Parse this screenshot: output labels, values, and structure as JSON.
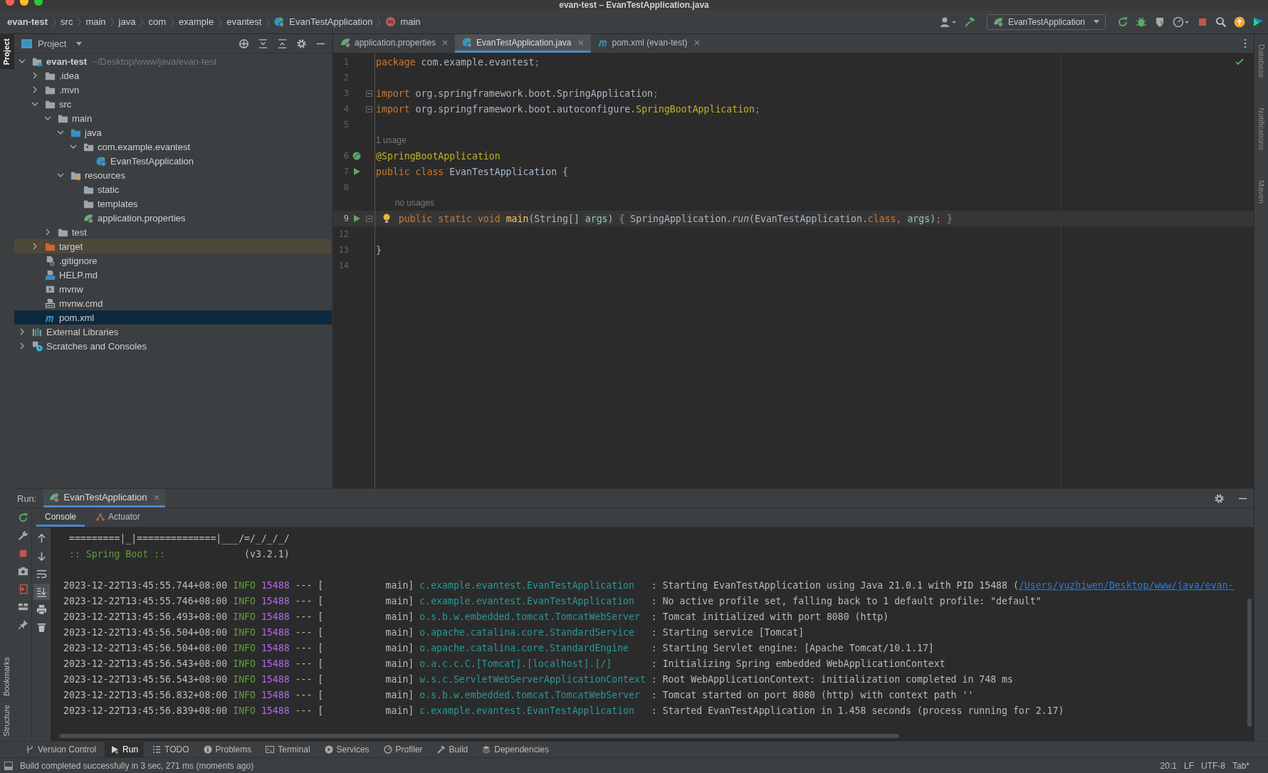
{
  "window": {
    "title": "evan-test – EvanTestApplication.java"
  },
  "breadcrumbs": [
    {
      "label": "evan-test",
      "kind": "project"
    },
    {
      "label": "src",
      "kind": "plain"
    },
    {
      "label": "main",
      "kind": "plain"
    },
    {
      "label": "java",
      "kind": "plain"
    },
    {
      "label": "com",
      "kind": "plain"
    },
    {
      "label": "example",
      "kind": "plain"
    },
    {
      "label": "evantest",
      "kind": "plain"
    },
    {
      "label": "EvanTestApplication",
      "kind": "class"
    },
    {
      "label": "main",
      "kind": "method"
    }
  ],
  "run_configuration": {
    "label": "EvanTestApplication"
  },
  "left_strip": {
    "top": [
      {
        "label": "Project",
        "selected": true
      }
    ],
    "bottom": [
      {
        "label": "Bookmarks",
        "selected": false
      },
      {
        "label": "Structure",
        "selected": false
      }
    ]
  },
  "right_strip": [
    {
      "label": "Database",
      "selected": false
    },
    {
      "label": "Notifications",
      "selected": false
    },
    {
      "label": "Maven",
      "selected": false
    }
  ],
  "project_panel": {
    "title": "Project",
    "tree": [
      {
        "label": "evan-test",
        "hint": "~/Desktop/www/java/evan-test",
        "kind": "module",
        "expanded": true,
        "selected": false,
        "children": [
          {
            "label": ".idea",
            "kind": "folder",
            "expanded": false,
            "selected": false
          },
          {
            "label": ".mvn",
            "kind": "folder",
            "expanded": false,
            "selected": false
          },
          {
            "label": "src",
            "kind": "folder",
            "expanded": true,
            "selected": false,
            "children": [
              {
                "label": "main",
                "kind": "folder",
                "expanded": true,
                "selected": false,
                "children": [
                  {
                    "label": "java",
                    "kind": "source-folder",
                    "expanded": true,
                    "selected": false,
                    "children": [
                      {
                        "label": "com.example.evantest",
                        "kind": "package",
                        "expanded": true,
                        "selected": false,
                        "children": [
                          {
                            "label": "EvanTestApplication",
                            "kind": "spring-class",
                            "selected": false
                          }
                        ]
                      }
                    ]
                  },
                  {
                    "label": "resources",
                    "kind": "resources-folder",
                    "expanded": true,
                    "selected": false,
                    "children": [
                      {
                        "label": "static",
                        "kind": "folder",
                        "selected": false
                      },
                      {
                        "label": "templates",
                        "kind": "folder",
                        "selected": false
                      },
                      {
                        "label": "application.properties",
                        "kind": "spring-file",
                        "selected": false
                      }
                    ]
                  }
                ]
              },
              {
                "label": "test",
                "kind": "folder",
                "expanded": false,
                "selected": false
              }
            ]
          },
          {
            "label": "target",
            "kind": "excluded-folder",
            "expanded": false,
            "selected": false
          },
          {
            "label": ".gitignore",
            "kind": "ignore-file",
            "selected": false
          },
          {
            "label": "HELP.md",
            "kind": "markdown-file",
            "selected": false
          },
          {
            "label": "mvnw",
            "kind": "script-file",
            "selected": false
          },
          {
            "label": "mvnw.cmd",
            "kind": "cmd-file",
            "selected": false
          },
          {
            "label": "pom.xml",
            "kind": "maven-file",
            "selected": true
          }
        ]
      },
      {
        "label": "External Libraries",
        "kind": "libraries",
        "expanded": false,
        "selected": false
      },
      {
        "label": "Scratches and Consoles",
        "kind": "scratches",
        "expanded": false,
        "selected": false
      }
    ]
  },
  "editor": {
    "tabs": [
      {
        "label": "application.properties",
        "kind": "spring-file",
        "selected": false
      },
      {
        "label": "EvanTestApplication.java",
        "kind": "spring-class",
        "selected": true
      },
      {
        "label": "pom.xml (evan-test)",
        "kind": "maven-file",
        "selected": false
      }
    ],
    "lines": [
      {
        "number": "1",
        "fold": false,
        "current": false,
        "tokens": [
          {
            "kind": "keyword",
            "text": "package "
          },
          {
            "kind": "plain",
            "text": "com.example.evantest"
          },
          {
            "kind": "keyword",
            "text": ";"
          }
        ]
      },
      {
        "number": "2",
        "fold": false,
        "current": false
      },
      {
        "number": "3",
        "fold": true,
        "current": false,
        "tokens": [
          {
            "kind": "keyword",
            "text": "import "
          },
          {
            "kind": "plain",
            "text": "org.springframework.boot.SpringApplication"
          },
          {
            "kind": "keyword",
            "text": ";"
          }
        ]
      },
      {
        "number": "4",
        "fold": true,
        "current": false,
        "tokens": [
          {
            "kind": "keyword",
            "text": "import "
          },
          {
            "kind": "plain",
            "text": "org.springframework.boot.autoconfigure."
          },
          {
            "kind": "annotation",
            "text": "SpringBootApplication"
          },
          {
            "kind": "keyword",
            "text": ";"
          }
        ]
      },
      {
        "number": "5",
        "fold": false,
        "current": false
      },
      {
        "number": "6",
        "hint": "1 usage",
        "gutter": {
          "kind": "bean"
        },
        "fold": false,
        "current": false,
        "tokens": [
          {
            "kind": "annotation",
            "text": "@SpringBootApplication"
          }
        ]
      },
      {
        "number": "7",
        "gutter": {
          "kind": "run"
        },
        "fold": false,
        "current": false,
        "tokens": [
          {
            "kind": "keyword",
            "text": "public class "
          },
          {
            "kind": "plain",
            "text": "EvanTestApplication {"
          }
        ]
      },
      {
        "number": "8",
        "fold": false,
        "current": false
      },
      {
        "number": "9",
        "hint": "no usages",
        "gutter": {
          "kind": "run"
        },
        "fold": true,
        "current": true,
        "intention": true,
        "tokens": [
          {
            "kind": "keyword",
            "text": "    public static void "
          },
          {
            "kind": "method",
            "text": "main"
          },
          {
            "kind": "plain",
            "text": "(String[] "
          },
          {
            "kind": "param",
            "text": "args"
          },
          {
            "kind": "plain",
            "text": ") "
          },
          {
            "kind": "folded",
            "text": "{"
          },
          {
            "kind": "plain",
            "text": " SpringApplication."
          },
          {
            "kind": "static-call",
            "text": "run"
          },
          {
            "kind": "plain",
            "text": "(EvanTestApplication."
          },
          {
            "kind": "keyword",
            "text": "class, "
          },
          {
            "kind": "param",
            "text": "args"
          },
          {
            "kind": "plain",
            "text": ")"
          },
          {
            "kind": "keyword",
            "text": "; "
          },
          {
            "kind": "folded",
            "text": "}"
          }
        ]
      },
      {
        "number": "12",
        "fold": false,
        "current": false
      },
      {
        "number": "13",
        "fold": false,
        "current": false,
        "tokens": [
          {
            "kind": "plain",
            "text": "}"
          }
        ]
      },
      {
        "number": "14",
        "fold": false,
        "current": false
      }
    ]
  },
  "run_panel": {
    "label": "Run:",
    "tabs": [
      {
        "label": "EvanTestApplication",
        "selected": true
      }
    ],
    "subtabs": [
      {
        "label": "Console",
        "kind": "console",
        "selected": true
      },
      {
        "label": "Actuator",
        "kind": "actuator",
        "selected": false
      }
    ],
    "console": {
      "banner_rule": " =========|_|==============|___/=/_/_/_/",
      "banner_label": " :: Spring Boot :: ",
      "banner_version": "             (v3.2.1)",
      "logs": [
        {
          "timestamp": "2023-12-22T13:45:55.744+08:00",
          "level": "INFO",
          "pid": "15488",
          "thread": "--- [           main]",
          "logger": "c.example.evantest.EvanTestApplication",
          "message": ": Starting EvanTestApplication using Java 21.0.1 with PID 15488 (",
          "link": "/Users/yuzhiwen/Desktop/www/java/evan-"
        },
        {
          "timestamp": "2023-12-22T13:45:55.746+08:00",
          "level": "INFO",
          "pid": "15488",
          "thread": "--- [           main]",
          "logger": "c.example.evantest.EvanTestApplication",
          "message": ": No active profile set, falling back to 1 default profile: \"default\""
        },
        {
          "timestamp": "2023-12-22T13:45:56.493+08:00",
          "level": "INFO",
          "pid": "15488",
          "thread": "--- [           main]",
          "logger": "o.s.b.w.embedded.tomcat.TomcatWebServer",
          "message": ": Tomcat initialized with port 8080 (http)"
        },
        {
          "timestamp": "2023-12-22T13:45:56.504+08:00",
          "level": "INFO",
          "pid": "15488",
          "thread": "--- [           main]",
          "logger": "o.apache.catalina.core.StandardService",
          "message": ": Starting service [Tomcat]"
        },
        {
          "timestamp": "2023-12-22T13:45:56.504+08:00",
          "level": "INFO",
          "pid": "15488",
          "thread": "--- [           main]",
          "logger": "o.apache.catalina.core.StandardEngine",
          "message": ": Starting Servlet engine: [Apache Tomcat/10.1.17]"
        },
        {
          "timestamp": "2023-12-22T13:45:56.543+08:00",
          "level": "INFO",
          "pid": "15488",
          "thread": "--- [           main]",
          "logger": "o.a.c.c.C.[Tomcat].[localhost].[/]",
          "message": ": Initializing Spring embedded WebApplicationContext"
        },
        {
          "timestamp": "2023-12-22T13:45:56.543+08:00",
          "level": "INFO",
          "pid": "15488",
          "thread": "--- [           main]",
          "logger": "w.s.c.ServletWebServerApplicationContext",
          "message": ": Root WebApplicationContext: initialization completed in 748 ms"
        },
        {
          "timestamp": "2023-12-22T13:45:56.832+08:00",
          "level": "INFO",
          "pid": "15488",
          "thread": "--- [           main]",
          "logger": "o.s.b.w.embedded.tomcat.TomcatWebServer",
          "message": ": Tomcat started on port 8080 (http) with context path ''"
        },
        {
          "timestamp": "2023-12-22T13:45:56.839+08:00",
          "level": "INFO",
          "pid": "15488",
          "thread": "--- [           main]",
          "logger": "c.example.evantest.EvanTestApplication",
          "message": ": Started EvanTestApplication in 1.458 seconds (process running for 2.17)"
        }
      ]
    }
  },
  "tool_tabs": [
    {
      "label": "Version Control",
      "kind": "vcs",
      "selected": false
    },
    {
      "label": "Run",
      "kind": "run",
      "selected": true
    },
    {
      "label": "TODO",
      "kind": "todo",
      "selected": false
    },
    {
      "label": "Problems",
      "kind": "problems",
      "selected": false
    },
    {
      "label": "Terminal",
      "kind": "terminal",
      "selected": false
    },
    {
      "label": "Services",
      "kind": "services",
      "selected": false
    },
    {
      "label": "Profiler",
      "kind": "profiler",
      "selected": false
    },
    {
      "label": "Build",
      "kind": "build",
      "selected": false
    },
    {
      "label": "Dependencies",
      "kind": "dependencies",
      "selected": false
    }
  ],
  "status_bar": {
    "message": "Build completed successfully in 3 sec, 271 ms (moments ago)",
    "position": "20:1",
    "line_separator": "LF",
    "encoding": "UTF-8",
    "indent": "Tab*"
  }
}
